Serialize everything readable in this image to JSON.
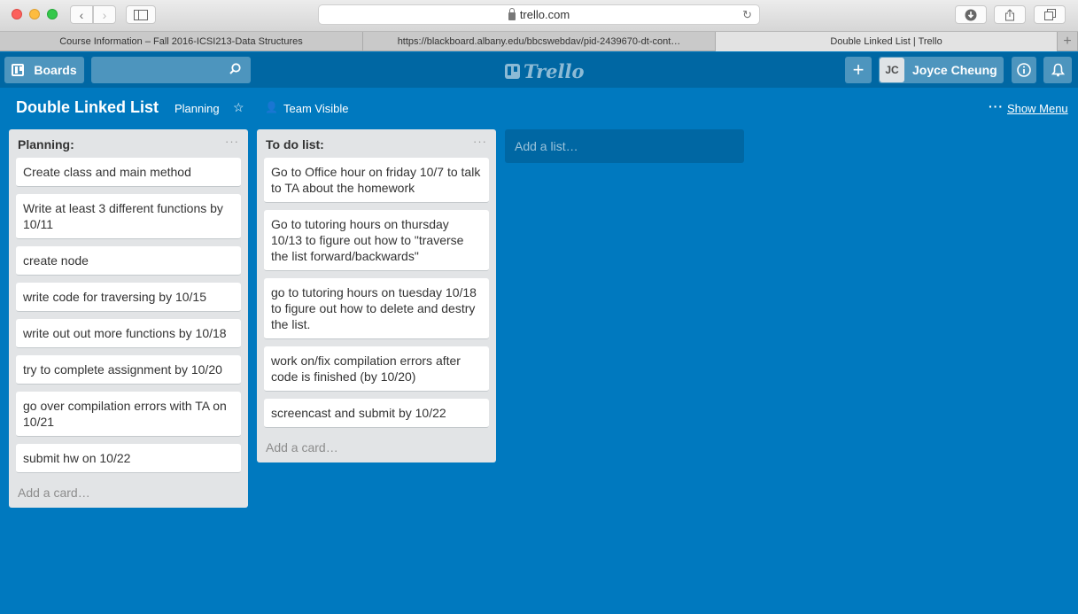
{
  "browser": {
    "url": "trello.com",
    "tabs": [
      "Course Information – Fall 2016-ICSI213-Data Structures",
      "https://blackboard.albany.edu/bbcswebdav/pid-2439670-dt-cont…",
      "Double Linked List | Trello"
    ]
  },
  "header": {
    "boards_label": "Boards",
    "logo_text": "Trello",
    "add_label": "+",
    "user_initials": "JC",
    "user_name": "Joyce Cheung"
  },
  "board": {
    "title": "Double Linked List",
    "team": "Planning",
    "visibility": "Team Visible",
    "show_menu": "Show Menu"
  },
  "lists": [
    {
      "title": "Planning:",
      "cards": [
        "Create class and main method",
        "Write at least 3 different functions by 10/11",
        "create node",
        "write code for traversing by 10/15",
        "write out out more functions by 10/18",
        "try to complete assignment by 10/20",
        "go over compilation errors with TA on 10/21",
        "submit hw on 10/22"
      ],
      "add_card": "Add a card…"
    },
    {
      "title": "To do list:",
      "cards": [
        "Go to Office hour on friday 10/7 to talk to TA about the homework",
        "Go to tutoring hours on thursday 10/13 to figure out how to \"traverse the list forward/backwards\"",
        "go to tutoring hours on tuesday 10/18 to figure out how to delete and destry the list.",
        "work on/fix compilation errors after code is finished (by 10/20)",
        "screencast and submit by 10/22"
      ],
      "add_card": "Add a card…"
    }
  ],
  "add_list": "Add a list…",
  "colors": {
    "board_bg": "#0079bf",
    "header_bg": "#0067a3",
    "list_bg": "#e2e4e6"
  }
}
